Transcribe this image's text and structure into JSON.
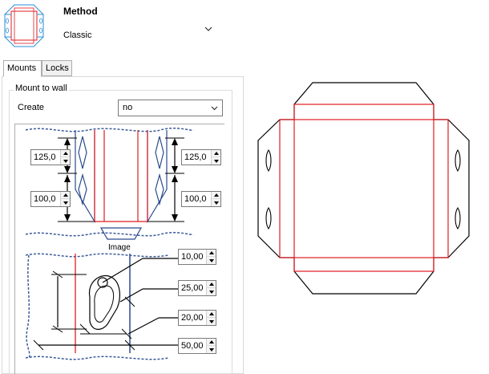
{
  "method": {
    "title": "Method",
    "value": "Classic"
  },
  "tabs": [
    {
      "label": "Mounts",
      "active": true
    },
    {
      "label": "Locks",
      "active": false
    }
  ],
  "mount_group": {
    "label": "Mount to wall",
    "create_label": "Create",
    "create_value": "no"
  },
  "upper_diagram": {
    "left_top_value": "125,0",
    "left_bottom_value": "100,0",
    "right_top_value": "125,0",
    "right_bottom_value": "100,0"
  },
  "image_label": "Image",
  "lower_diagram": {
    "values": [
      "10,00",
      "25,00",
      "20,00",
      "50,00"
    ]
  },
  "colors": {
    "cut_line": "#000000",
    "crease_line": "#e11b22",
    "wall_line": "#2a4a8c",
    "dashed_edge": "#3a5a9a"
  }
}
